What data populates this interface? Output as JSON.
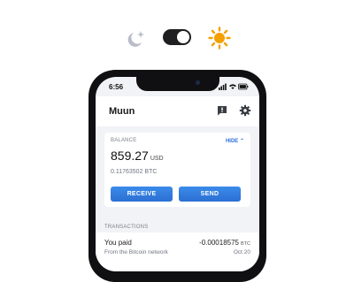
{
  "theme_switcher": {
    "dark_icon": "moon-stars-icon",
    "light_icon": "sun-icon",
    "mode": "dark-toggle-on"
  },
  "status_bar": {
    "time": "6:56"
  },
  "app": {
    "title": "Muun",
    "feedback_icon": "chat-feedback-icon",
    "settings_icon": "gear-icon"
  },
  "balance": {
    "label": "BALANCE",
    "hide_label": "HIDE",
    "amount": "859.27",
    "currency": "USD",
    "btc_amount": "0.11763502 BTC"
  },
  "actions": {
    "receive_label": "RECEIVE",
    "send_label": "SEND"
  },
  "transactions": {
    "label": "TRANSACTIONS",
    "items": [
      {
        "title": "You paid",
        "subtitle": "From the Bitcoin network",
        "amount": "-0.00018575",
        "unit": "BTC",
        "date": "Oct 20"
      }
    ]
  },
  "colors": {
    "accent": "#2f6fd8",
    "button": "#3a8bea",
    "sun": "#f4a000",
    "moon": "#b9bcc9"
  }
}
